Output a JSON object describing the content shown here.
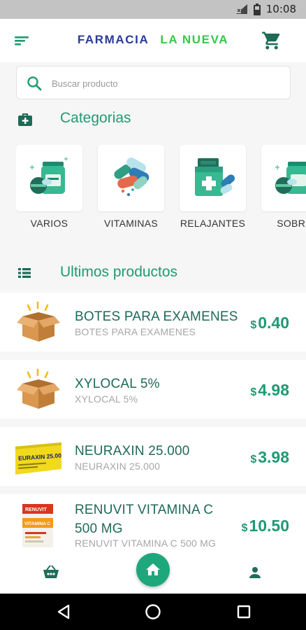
{
  "status_bar": {
    "time": "10:08"
  },
  "header": {
    "brand_part1": "FARMACIA",
    "brand_part2": "LA NUEVA",
    "brand_colors": [
      "#2b3a9a",
      "#35c84a"
    ]
  },
  "search": {
    "placeholder": "Buscar producto"
  },
  "categories_section": {
    "title": "Categorias",
    "items": [
      {
        "label": "VARIOS",
        "icon": "pills-bottle-icon"
      },
      {
        "label": "VITAMINAS",
        "icon": "capsules-icon"
      },
      {
        "label": "RELAJANTES",
        "icon": "medicine-box-icon"
      },
      {
        "label": "SOBRE",
        "icon": "pills-bottle-icon"
      }
    ]
  },
  "products_section": {
    "title": "Ultimos productos",
    "items": [
      {
        "name": "BOTES PARA EXAMENES",
        "name_line2": "",
        "subtitle": "BOTES PARA EXAMENES",
        "currency": "$",
        "price": "0.40",
        "image": "open-box-image"
      },
      {
        "name": "XYLOCAL 5%",
        "name_line2": "",
        "subtitle": "XYLOCAL 5%",
        "currency": "$",
        "price": "4.98",
        "image": "open-box-image"
      },
      {
        "name": "NEURAXIN 25.000",
        "name_line2": "",
        "subtitle": "NEURAXIN 25.000",
        "currency": "$",
        "price": "3.98",
        "image": "neuraxin-pack-image"
      },
      {
        "name": "RENUVIT VITAMINA C",
        "name_line2": "500 MG",
        "subtitle": "RENUVIT VITAMINA C 500 MG",
        "currency": "$",
        "price": "10.50",
        "image": "renuvit-pack-image"
      }
    ]
  },
  "product_images": {
    "neuraxin_text": "EURAXIN 25.000",
    "renuvit_brand": "RENUVIT",
    "renuvit_label": "VITAMINA C"
  },
  "bottom_nav": {
    "items": [
      "basket-icon",
      "home-icon",
      "user-icon"
    ]
  },
  "colors": {
    "accent": "#1f9b73",
    "dark_green": "#1e6a55"
  }
}
